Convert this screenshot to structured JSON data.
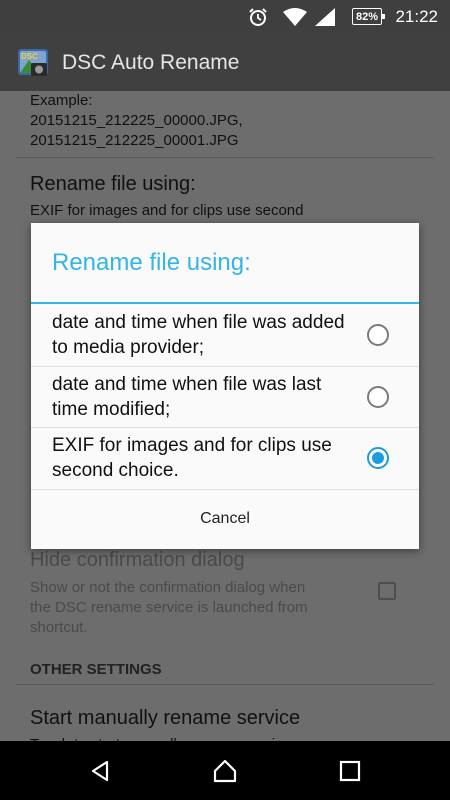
{
  "status_bar": {
    "time": "21:22",
    "battery": "82%",
    "icons": [
      "alarm-icon",
      "wifi-icon",
      "signal-icon",
      "battery-icon"
    ]
  },
  "action_bar": {
    "title": "DSC Auto Rename",
    "logo_icon": "camera-logo-icon"
  },
  "settings": {
    "example_label": "Example:",
    "example_line1": "20151215_212225_00000.JPG,",
    "example_line2": "20151215_212225_00001.JPG",
    "rename_title": "Rename file using:",
    "rename_summary": "EXIF for images and for clips use second",
    "hide_title": "Hide confirmation dialog",
    "hide_summary": "Show or not the confirmation dialog when the DSC rename service is launched from shortcut.",
    "other_settings_header": "OTHER SETTINGS",
    "start_title": "Start manually rename service",
    "start_summary": "Touch to start manually rename service"
  },
  "dialog": {
    "title": "Rename file using:",
    "options": [
      {
        "label": "date and time when file was added to media provider;",
        "selected": false
      },
      {
        "label": "date and time when file was last time modified;",
        "selected": false
      },
      {
        "label": "EXIF for images and for clips use second choice.",
        "selected": true
      }
    ],
    "cancel_label": "Cancel"
  },
  "nav_bar": {
    "icons": [
      "back-icon",
      "home-icon",
      "recent-apps-icon"
    ]
  },
  "colors": {
    "accent": "#33b5e5",
    "radio_checked": "#1e9ae0",
    "action_bar": "#404040",
    "status_bar": "#3f3f3f"
  }
}
